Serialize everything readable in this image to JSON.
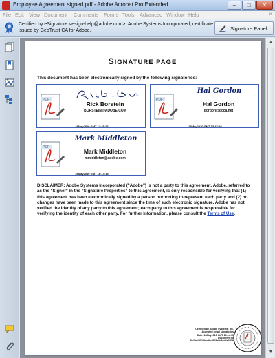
{
  "window": {
    "title": "Employee Agreement signed.pdf - Adobe Acrobat Pro Extended",
    "minimize": "–",
    "maximize": "□",
    "close": "✕"
  },
  "menu": {
    "items": [
      "File",
      "Edit",
      "View",
      "Document",
      "Comments",
      "Forms",
      "Tools",
      "Advanced",
      "Window",
      "Help"
    ],
    "close": "×"
  },
  "signature_bar": {
    "message": "Certified by eSignature <esign-help@adobe.com>, Adobe Systems Incorporated, certificate issued by GeoTrust CA for Adobe.",
    "panel_button": "Signature Panel",
    "icon": "certificate-ribbon-icon"
  },
  "left_panel": {
    "icons": [
      "pages-icon",
      "bookmarks-icon",
      "signatures-icon",
      "layers-icon",
      "comments-icon",
      "attachments-icon"
    ]
  },
  "document": {
    "title": "Signature Page",
    "intro": "This document has been electronically signed by the following signatories:",
    "signatories": [
      {
        "signature": "Richard D. Borstein",
        "name": "Rick Borstein",
        "email": "BORSTEIN@ADOBE.COM",
        "timestamp": "28May2010 GMT 13:45:22"
      },
      {
        "signature": "Hal Gordon",
        "name": "Hal Gordon",
        "email": "gordon@gcca.net",
        "timestamp": "28May2010 GMT 13:47:29"
      },
      {
        "signature": "Mark Middleton",
        "name": "Mark Middleton",
        "email": "mmiddleton@adobe.com",
        "timestamp": "28May2010 GMT 16:14:15"
      }
    ],
    "disclaimer": "DISCLAIMER: Adobe Systems Incorporated (\"Adobe\") is not a party to this agreement. Adobe, referred to as the \"Signer\" in the \"Signature Properties\" to this agreement, is only responsible for verifying that (1) this agreement has been electronically signed by a person purporting to represent each party and (2) no changes have been made to this agreement since the time of such electronic signature. Adobe has not verified the identity of any party to this agreement; each party to this agreement is responsible for verifying the identity of each other party. For further information, please consult the",
    "terms_link": "Terms of Use",
    "terms_end": ".",
    "seal_text": [
      "Certified by Adobe Systems, Inc.",
      "Accepted by all signatories",
      "Date: 28May2010 GMT 16:14:15",
      "Document Id:",
      "8b39e4302f8ae90cf815e0b8ed4a3d3b"
    ]
  },
  "colors": {
    "accent": "#3d5fb5",
    "pdf_red": "#c8261e",
    "link": "#1a3fb0"
  }
}
